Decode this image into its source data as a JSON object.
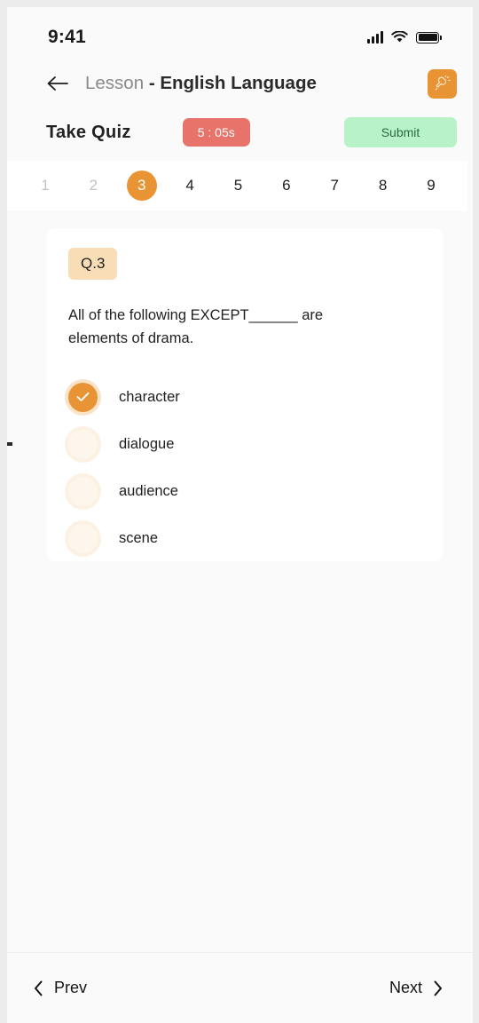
{
  "status_bar": {
    "time": "9:41",
    "signal_icon": "cellular-signal-icon",
    "wifi_icon": "wifi-icon",
    "battery_icon": "battery-full-icon"
  },
  "header": {
    "back_icon": "back-arrow-icon",
    "title_prefix": "Lesson ",
    "title_main": "- English Language",
    "action_icon": "sparkle-announcement-icon",
    "action_button_color": "#e89434"
  },
  "quiz_bar": {
    "heading": "Take Quiz",
    "timer": "5 : 05s",
    "timer_color": "#e8736a",
    "submit_label": "Submit",
    "submit_color": "#b8f2c8"
  },
  "tabs": {
    "active_index": 2,
    "items": [
      {
        "label": "1",
        "state": "done"
      },
      {
        "label": "2",
        "state": "done"
      },
      {
        "label": "3",
        "state": "active"
      },
      {
        "label": "4",
        "state": "upcoming"
      },
      {
        "label": "5",
        "state": "upcoming"
      },
      {
        "label": "6",
        "state": "upcoming"
      },
      {
        "label": "7",
        "state": "upcoming"
      },
      {
        "label": "8",
        "state": "upcoming"
      },
      {
        "label": "9",
        "state": "upcoming"
      }
    ]
  },
  "question": {
    "badge": "Q.3",
    "badge_color": "#f8ddb7",
    "text": "All of the following EXCEPT______ are elements of drama.",
    "selected_option": "character",
    "options": [
      {
        "label": "character",
        "selected": true
      },
      {
        "label": "dialogue",
        "selected": false
      },
      {
        "label": "audience",
        "selected": false
      },
      {
        "label": "scene",
        "selected": false
      }
    ]
  },
  "bottom_nav": {
    "prev_label": "Prev",
    "prev_icon": "chevron-left-icon",
    "next_label": "Next",
    "next_icon": "chevron-right-icon"
  }
}
